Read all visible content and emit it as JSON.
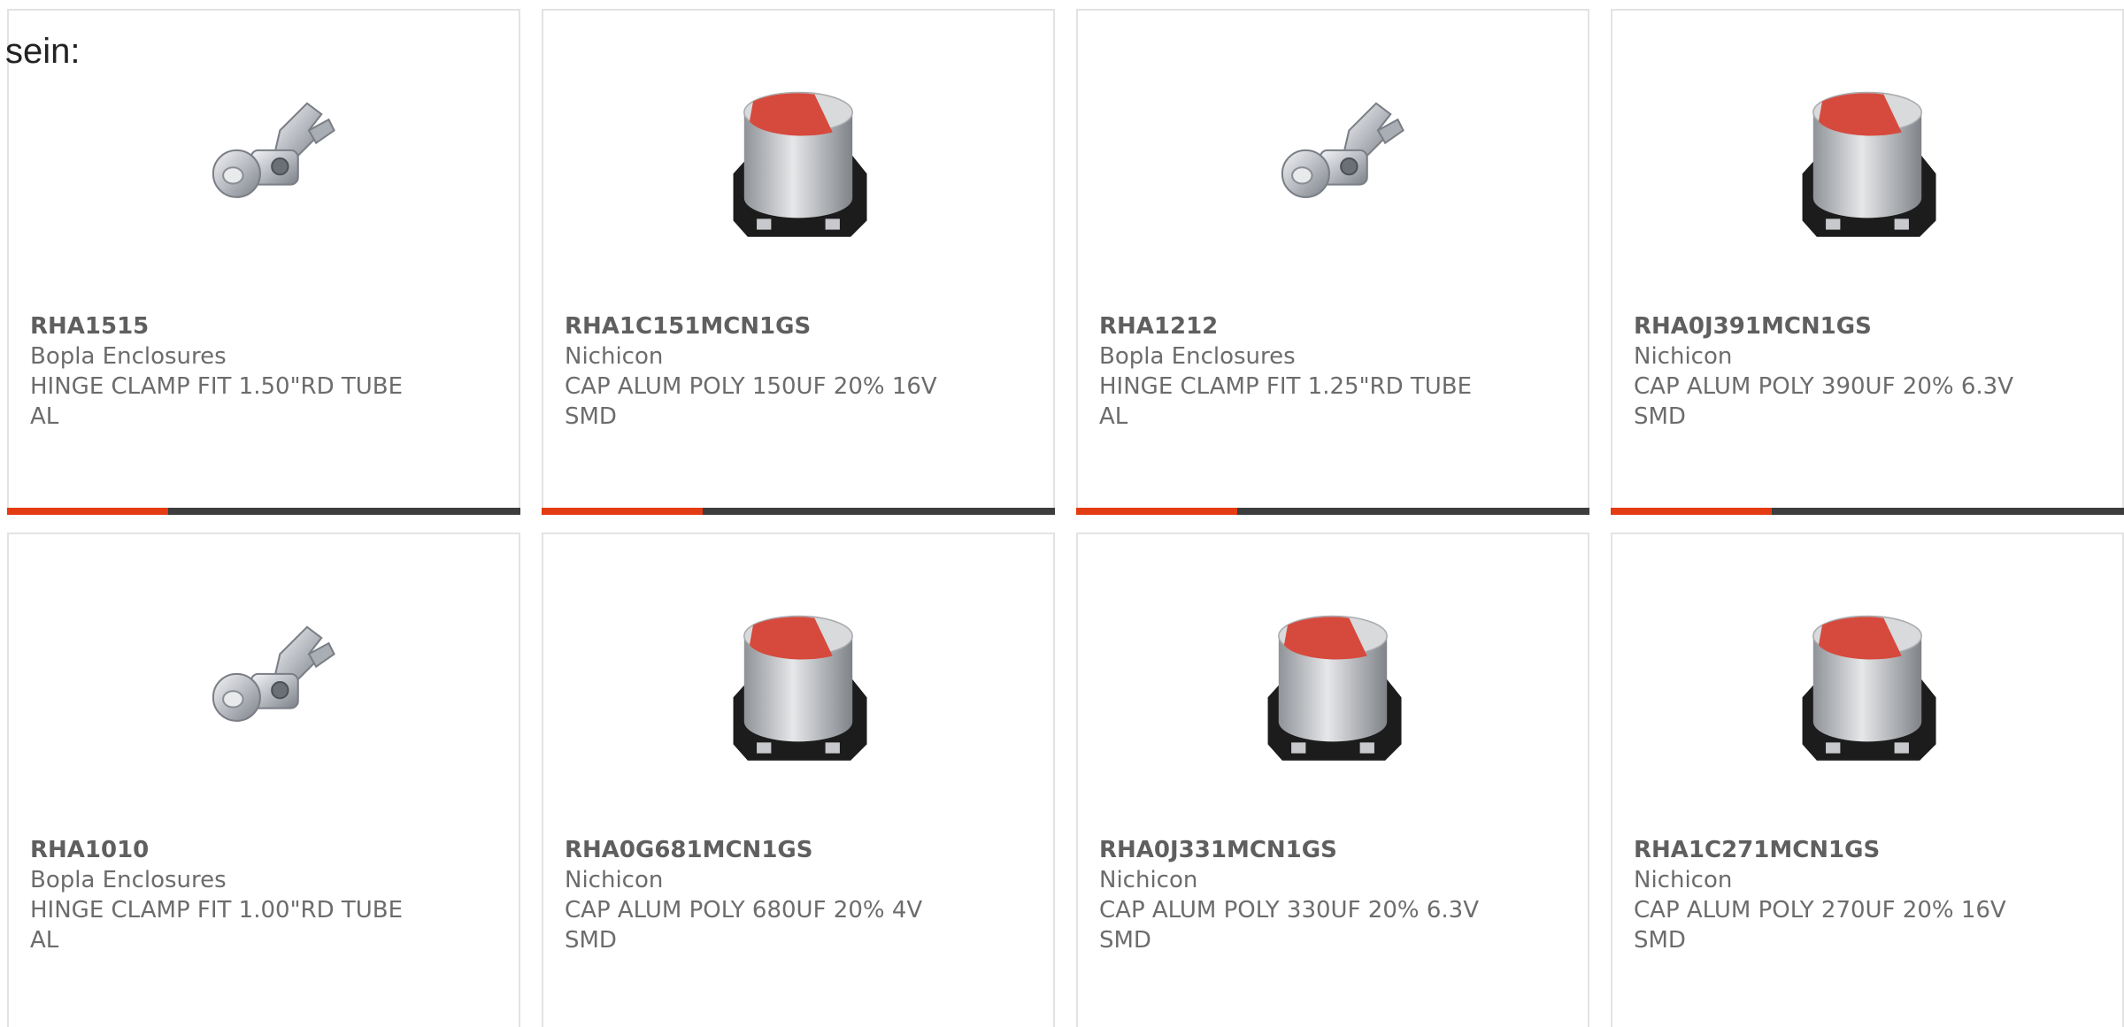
{
  "prefix_text": "sein:",
  "brand_colors": {
    "accent": "#e33b12",
    "bar_dark": "#3d3d3d",
    "card_border": "#e3e3e3",
    "text_gray": "#6c6c6c"
  },
  "products": [
    {
      "part": "RHA1515",
      "maker": "Bopla Enclosures",
      "desc": "HINGE CLAMP FIT 1.50\"RD TUBE AL",
      "image": "hinge-clamp-icon"
    },
    {
      "part": "RHA1C151MCN1GS",
      "maker": "Nichicon",
      "desc": "CAP ALUM POLY 150UF 20% 16V SMD",
      "image": "capacitor-icon"
    },
    {
      "part": "RHA1212",
      "maker": "Bopla Enclosures",
      "desc": "HINGE CLAMP FIT 1.25\"RD TUBE AL",
      "image": "hinge-clamp-icon"
    },
    {
      "part": "RHA0J391MCN1GS",
      "maker": "Nichicon",
      "desc": "CAP ALUM POLY 390UF 20% 6.3V SMD",
      "image": "capacitor-icon"
    },
    {
      "part": "RHA1010",
      "maker": "Bopla Enclosures",
      "desc": "HINGE CLAMP FIT 1.00\"RD TUBE AL",
      "image": "hinge-clamp-icon"
    },
    {
      "part": "RHA0G681MCN1GS",
      "maker": "Nichicon",
      "desc": "CAP ALUM POLY 680UF 20% 4V SMD",
      "image": "capacitor-icon"
    },
    {
      "part": "RHA0J331MCN1GS",
      "maker": "Nichicon",
      "desc": "CAP ALUM POLY 330UF 20% 6.3V SMD",
      "image": "capacitor-icon"
    },
    {
      "part": "RHA1C271MCN1GS",
      "maker": "Nichicon",
      "desc": "CAP ALUM POLY 270UF 20% 16V SMD",
      "image": "capacitor-icon"
    }
  ]
}
